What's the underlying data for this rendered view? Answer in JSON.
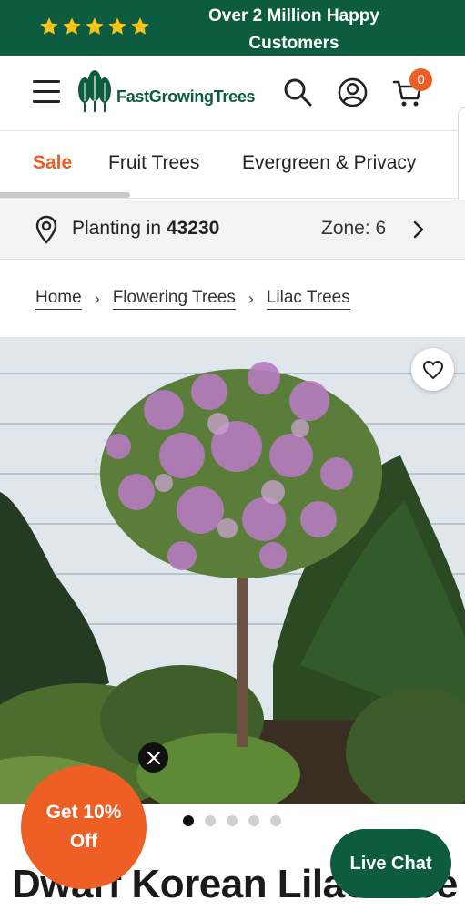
{
  "promo": {
    "text": "Over 2 Million Happy Customers",
    "rating": 5,
    "star_color": "#f5c518",
    "bg_color": "#0d5c3f"
  },
  "header": {
    "logo_text": "FastGrowingTrees",
    "menu_icon": "hamburger-icon",
    "search_icon": "search-icon",
    "account_icon": "account-icon",
    "cart_icon": "cart-icon",
    "cart_count": "0"
  },
  "categories": [
    {
      "label": "Sale",
      "active": true
    },
    {
      "label": "Fruit Trees"
    },
    {
      "label": "Evergreen & Privacy"
    }
  ],
  "zone_bar": {
    "planting_prefix": "Planting in",
    "zip": "43230",
    "zone_label": "Zone: 6"
  },
  "breadcrumb": [
    "Home",
    "Flowering Trees",
    "Lilac Trees"
  ],
  "carousel": {
    "total": 5,
    "active": 1
  },
  "product": {
    "title": "Dwarf Korean Lilac Tree"
  },
  "popups": {
    "discount_line1": "Get 10%",
    "discount_line2": "Off",
    "live_chat": "Live Chat"
  },
  "colors": {
    "accent": "#ee5f25",
    "brand": "#0d5c3f"
  }
}
